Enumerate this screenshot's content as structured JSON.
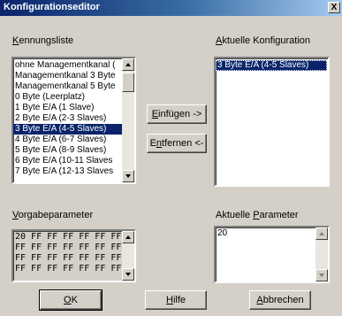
{
  "window": {
    "title": "Konfigurationseditor",
    "close_label": "X"
  },
  "kennungsliste": {
    "label": "Kennungsliste",
    "items": [
      "ohne Managementkanal (",
      "Managementkanal 3 Byte",
      "Managementkanal 5 Byte",
      "0 Byte (Leerplatz)",
      "1 Byte E/A (1 Slave)",
      "2 Byte E/A (2-3 Slaves)",
      "3 Byte E/A (4-5 Slaves)",
      "4 Byte E/A (6-7 Slaves)",
      "5 Byte E/A (8-9 Slaves)",
      "6 Byte E/A (10-11 Slaves",
      "7 Byte E/A (12-13 Slaves"
    ],
    "selected_index": 6
  },
  "aktuelle_konfiguration": {
    "label": "Aktuelle Konfiguration",
    "items": [
      "3 Byte E/A (4-5 Slaves)"
    ]
  },
  "buttons": {
    "einfuegen": "Einfügen ->",
    "entfernen": "Entfernen <-",
    "ok": "OK",
    "hilfe": "Hilfe",
    "abbrechen": "Abbrechen"
  },
  "vorgabeparameter": {
    "label": "Vorgabeparameter",
    "lines": [
      "20 FF FF FF FF FF FF FF",
      "FF FF FF FF FF FF FF FF",
      "FF FF FF FF FF FF FF FF",
      "FF FF FF FF FF FF FF FF"
    ]
  },
  "aktuelle_parameter": {
    "label": "Aktuelle Parameter",
    "value": "20"
  },
  "colors": {
    "selection": "#0a246a",
    "face": "#d4d0c8",
    "title_start": "#0a246a"
  }
}
